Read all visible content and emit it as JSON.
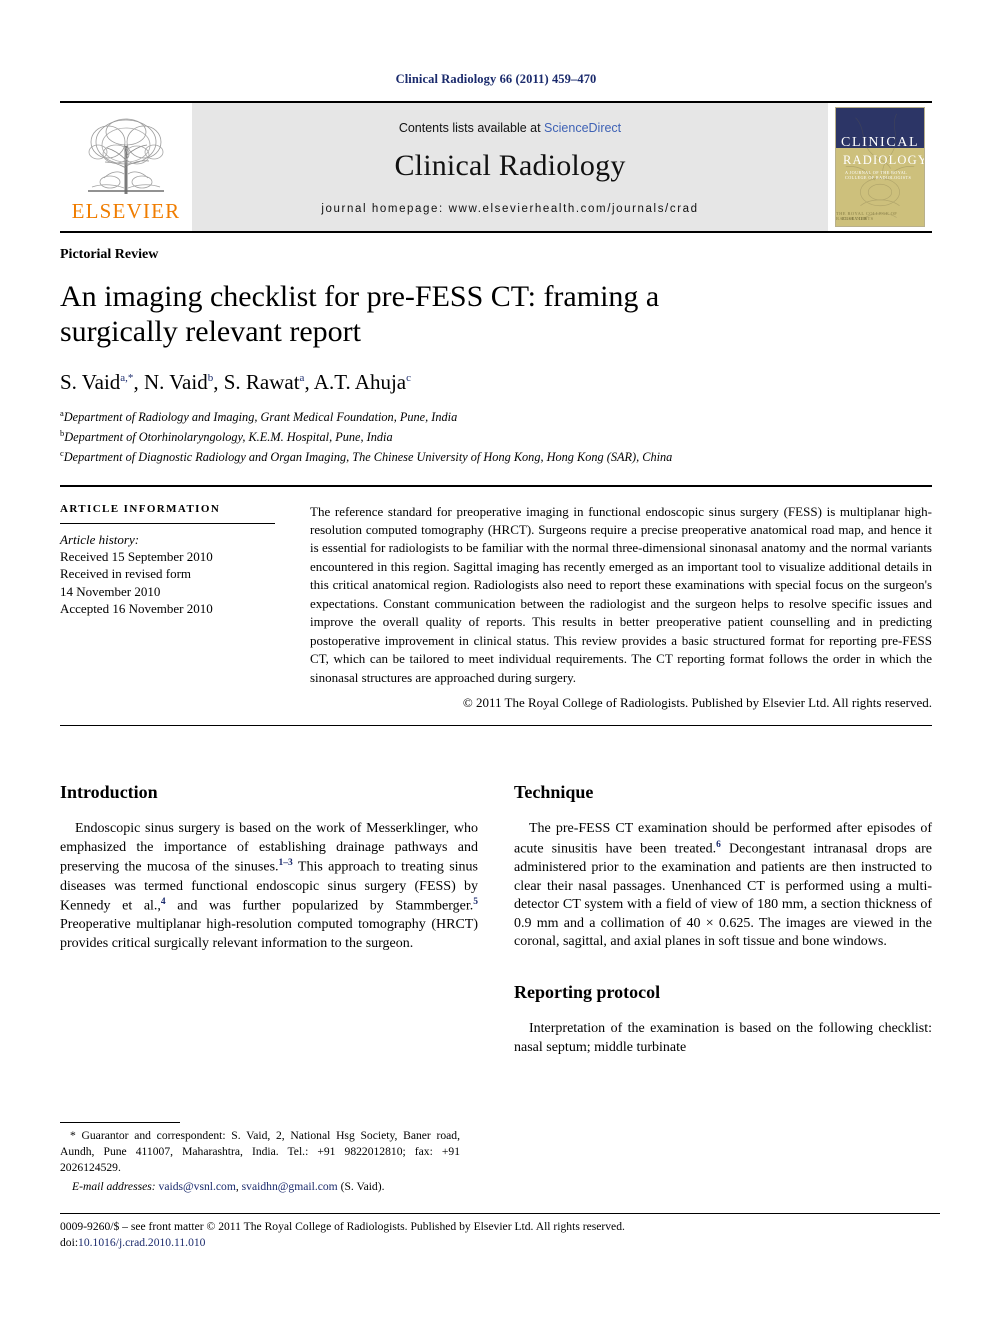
{
  "running_head": "Clinical Radiology 66 (2011) 459–470",
  "masthead": {
    "publisher_name": "ELSEVIER",
    "contents_prefix": "Contents lists available at ",
    "contents_link": "ScienceDirect",
    "journal_name": "Clinical Radiology",
    "homepage": "journal homepage: www.elsevierhealth.com/journals/crad",
    "cover": {
      "line1": "CLINICAL",
      "line2": "RADIOLOGY",
      "subtitle": "A JOURNAL OF THE ROYAL COLLEGE OF RADIOLOGISTS",
      "brand_left": "ELSEVIER",
      "brand_right": "THE ROYAL COLLEGE OF RADIOLOGISTS",
      "color_top": "#2c3566",
      "color_body": "#cdc07c"
    }
  },
  "article": {
    "doctype": "Pictorial Review",
    "title": "An imaging checklist for pre-FESS CT: framing a surgically relevant report",
    "authors": [
      {
        "name": "S. Vaid",
        "marks": "a,*"
      },
      {
        "name": "N. Vaid",
        "marks": "b"
      },
      {
        "name": "S. Rawat",
        "marks": "a"
      },
      {
        "name": "A.T. Ahuja",
        "marks": "c"
      }
    ],
    "affiliations": [
      {
        "mark": "a",
        "text": "Department of Radiology and Imaging, Grant Medical Foundation, Pune, India"
      },
      {
        "mark": "b",
        "text": "Department of Otorhinolaryngology, K.E.M. Hospital, Pune, India"
      },
      {
        "mark": "c",
        "text": "Department of Diagnostic Radiology and Organ Imaging, The Chinese University of Hong Kong, Hong Kong (SAR), China"
      }
    ]
  },
  "article_info": {
    "heading": "ARTICLE INFORMATION",
    "history_label": "Article history:",
    "history": [
      "Received 15 September 2010",
      "Received in revised form",
      "14 November 2010",
      "Accepted 16 November 2010"
    ]
  },
  "abstract": {
    "text": "The reference standard for preoperative imaging in functional endoscopic sinus surgery (FESS) is multiplanar high-resolution computed tomography (HRCT). Surgeons require a precise preoperative anatomical road map, and hence it is essential for radiologists to be familiar with the normal three-dimensional sinonasal anatomy and the normal variants encountered in this region. Sagittal imaging has recently emerged as an important tool to visualize additional details in this critical anatomical region. Radiologists also need to report these examinations with special focus on the surgeon's expectations. Constant communication between the radiologist and the surgeon helps to resolve specific issues and improve the overall quality of reports. This results in better preoperative patient counselling and in predicting postoperative improvement in clinical status. This review provides a basic structured format for reporting pre-FESS CT, which can be tailored to meet individual requirements. The CT reporting format follows the order in which the sinonasal structures are approached during surgery.",
    "copyright": "© 2011 The Royal College of Radiologists. Published by Elsevier Ltd. All rights reserved."
  },
  "sections": {
    "introduction": {
      "heading": "Introduction",
      "paragraph_pre1": "Endoscopic sinus surgery is based on the work of Messerklinger, who emphasized the importance of establishing drainage pathways and preserving the mucosa of the sinuses.",
      "ref1": "1–3",
      "paragraph_pre2": " This approach to treating sinus diseases was termed functional endoscopic sinus surgery (FESS) by Kennedy et al.,",
      "ref2": "4",
      "paragraph_pre3": " and was further popularized by Stammberger.",
      "ref3": "5",
      "paragraph_pre4": " Preoperative multiplanar high-resolution computed tomography (HRCT) provides critical surgically relevant information to the surgeon."
    },
    "technique": {
      "heading": "Technique",
      "paragraph_pre1": "The pre-FESS CT examination should be performed after episodes of acute sinusitis have been treated.",
      "ref1": "6",
      "paragraph_pre2": " Decongestant intranasal drops are administered prior to the examination and patients are then instructed to clear their nasal passages. Unenhanced CT is performed using a multi-detector CT system with a field of view of 180 mm, a section thickness of 0.9 mm and a collimation of 40 × 0.625. The images are viewed in the coronal, sagittal, and axial planes in soft tissue and bone windows."
    },
    "reporting_protocol": {
      "heading": "Reporting protocol",
      "paragraph": "Interpretation of the examination is based on the following checklist: nasal septum; middle turbinate"
    }
  },
  "footnote": {
    "text": "* Guarantor and correspondent: S. Vaid, 2, National Hsg Society, Baner road, Aundh, Pune 411007, Maharashtra, India. Tel.: +91 9822012810; fax: +91 2026124529.",
    "email_label": "E-mail addresses:",
    "email1": "vaids@vsnl.com",
    "email_sep": ", ",
    "email2": "svaidhn@gmail.com",
    "email_suffix": " (S. Vaid)."
  },
  "page_footer": {
    "issn_line": "0009-9260/$ – see front matter © 2011 The Royal College of Radiologists. Published by Elsevier Ltd. All rights reserved.",
    "doi_label": "doi:",
    "doi_value": "10.1016/j.crad.2010.11.010"
  }
}
